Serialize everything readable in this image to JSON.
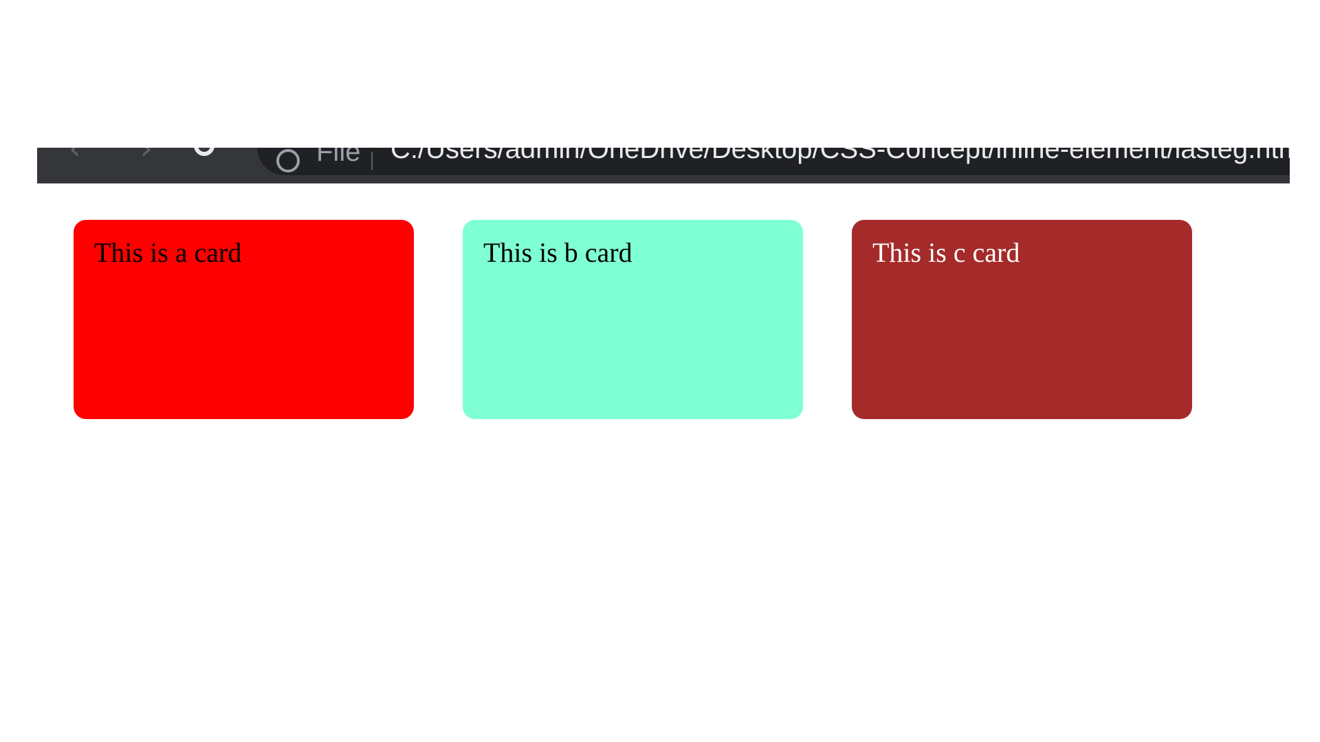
{
  "browser": {
    "back_icon": "back-arrow-icon",
    "forward_icon": "forward-arrow-icon",
    "reload_icon": "reload-icon",
    "info_icon": "info-icon",
    "scheme_label": "File",
    "url": "C:/Users/admin/OneDrive/Desktop/CSS-Concept/inline-element/lasteg.html"
  },
  "cards": [
    {
      "label": "This is a card",
      "color": "#ff0000"
    },
    {
      "label": "This is b card",
      "color": "#7fffd4"
    },
    {
      "label": "This is c card",
      "color": "#a52a2a"
    }
  ]
}
